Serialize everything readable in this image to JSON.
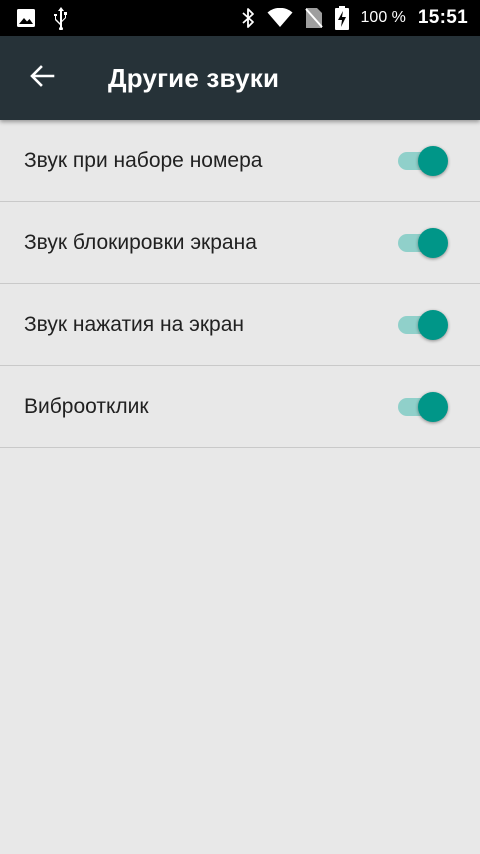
{
  "status_bar": {
    "icons_left": [
      "image-icon",
      "usb-icon"
    ],
    "icons_right": [
      "bluetooth-icon",
      "wifi-icon",
      "no-sim-icon",
      "battery-charging-icon"
    ],
    "battery_text": "100 %",
    "time": "15:51"
  },
  "toolbar": {
    "back_icon": "arrow-back-icon",
    "title": "Другие звуки",
    "background_color": "#263238"
  },
  "settings": [
    {
      "label": "Звук при наборе номера",
      "enabled": true
    },
    {
      "label": "Звук блокировки экрана",
      "enabled": true
    },
    {
      "label": "Звук нажатия на экран",
      "enabled": true
    },
    {
      "label": "Виброотклик",
      "enabled": true
    }
  ],
  "colors": {
    "accent": "#009688",
    "track": "#80cbc4",
    "background": "#e8e8e8"
  }
}
